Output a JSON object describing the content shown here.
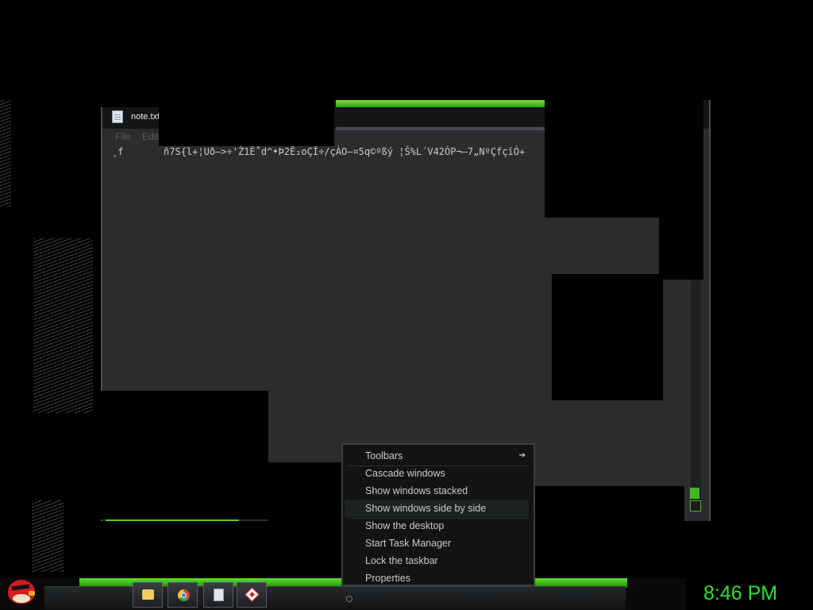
{
  "notepad": {
    "title": "note.txt",
    "menu": [
      "File",
      "Edit"
    ],
    "content_line_1": "¸f       ñ7S{l+¦Uð–>÷'Ž1Ë˚d^•Þ2Ê₂oÇÎ÷/çÀO—¤5q©ºßý ¦Š%L´V42ÓP¬–7„NºÇfçïÓ+"
  },
  "context_menu": {
    "items": [
      {
        "label": "Toolbars"
      },
      {
        "label": "Cascade windows"
      },
      {
        "label": "Show windows stacked"
      },
      {
        "label": "Show windows side by side"
      },
      {
        "label": "Show the desktop"
      },
      {
        "label": "Start Task Manager"
      },
      {
        "label": "Lock the taskbar"
      },
      {
        "label": "Properties"
      }
    ],
    "submenu_arrow": "➔",
    "hovered_index": 3
  },
  "taskbar": {
    "pinned": [
      {
        "name": "folder-icon"
      },
      {
        "name": "chrome-icon"
      },
      {
        "name": "notepad-icon"
      },
      {
        "name": "app-icon"
      }
    ],
    "start_icon": "angry-bird-icon"
  },
  "clock": {
    "time": "8:46 PM"
  },
  "colors": {
    "accent": "#2fe02f",
    "taskbar_green": "#5fe02a",
    "window_bg": "#2a2c2e"
  }
}
